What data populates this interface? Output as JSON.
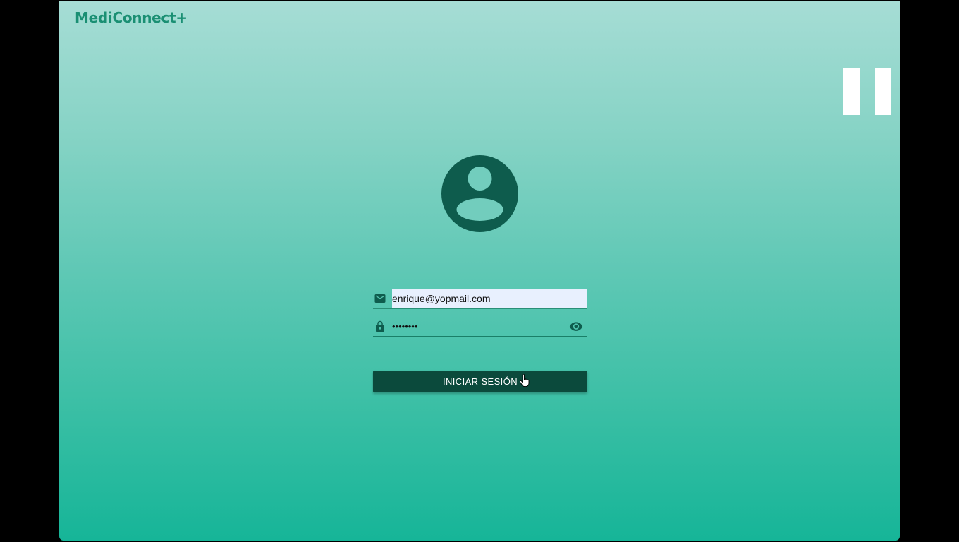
{
  "app": {
    "brand": "MediConnect+"
  },
  "login": {
    "email_value": "enrique@yopmail.com",
    "password_value": "••••••••",
    "submit_label": "INICIAR SESIÓN"
  },
  "icons": {
    "avatar": "account-circle-icon",
    "email": "mail-icon",
    "password": "lock-icon",
    "visibility": "eye-icon",
    "video_overlay": "pause-icon",
    "pointer": "hand-cursor-icon"
  },
  "colors": {
    "brand_text": "#1a8f73",
    "primary_dark": "#0b4a3c",
    "icon_dark": "#0e5c4d",
    "gradient_top": "#a6ddd5",
    "gradient_bottom": "#16b598",
    "autofill_bg": "#e8f0fe"
  }
}
